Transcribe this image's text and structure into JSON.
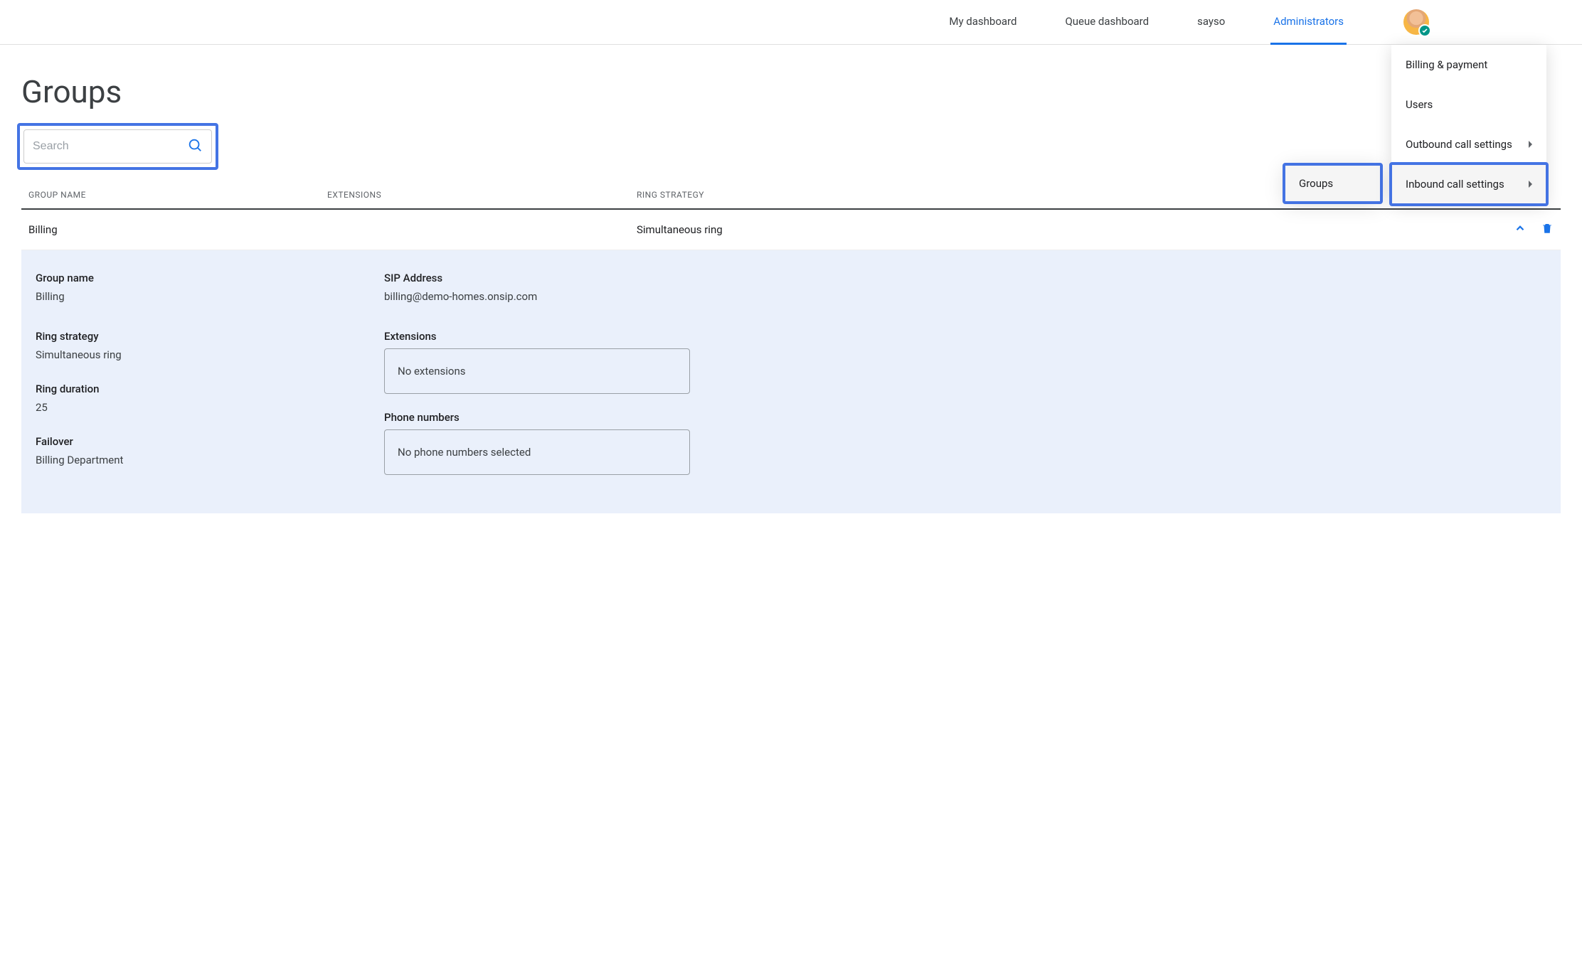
{
  "nav": {
    "items": [
      {
        "label": "My dashboard"
      },
      {
        "label": "Queue dashboard"
      },
      {
        "label": "sayso"
      },
      {
        "label": "Administrators"
      }
    ]
  },
  "dropdown": {
    "items": [
      {
        "label": "Billing & payment",
        "has_sub": false
      },
      {
        "label": "Users",
        "has_sub": false
      },
      {
        "label": "Outbound call settings",
        "has_sub": true
      },
      {
        "label": "Inbound call settings",
        "has_sub": true,
        "highlighted": true
      }
    ]
  },
  "submenu": {
    "item": "Groups"
  },
  "page": {
    "title": "Groups",
    "search_placeholder": "Search"
  },
  "table": {
    "headers": {
      "name": "GROUP NAME",
      "ext": "EXTENSIONS",
      "ring": "RING STRATEGY"
    },
    "row": {
      "name": "Billing",
      "ext": "",
      "ring": "Simultaneous ring"
    }
  },
  "details": {
    "group_name_label": "Group name",
    "group_name_value": "Billing",
    "ring_strategy_label": "Ring strategy",
    "ring_strategy_value": "Simultaneous ring",
    "ring_duration_label": "Ring duration",
    "ring_duration_value": "25",
    "failover_label": "Failover",
    "failover_value": "Billing Department",
    "sip_label": "SIP Address",
    "sip_value": "billing@demo-homes.onsip.com",
    "extensions_label": "Extensions",
    "extensions_value": "No extensions",
    "phone_label": "Phone numbers",
    "phone_value": "No phone numbers selected"
  }
}
